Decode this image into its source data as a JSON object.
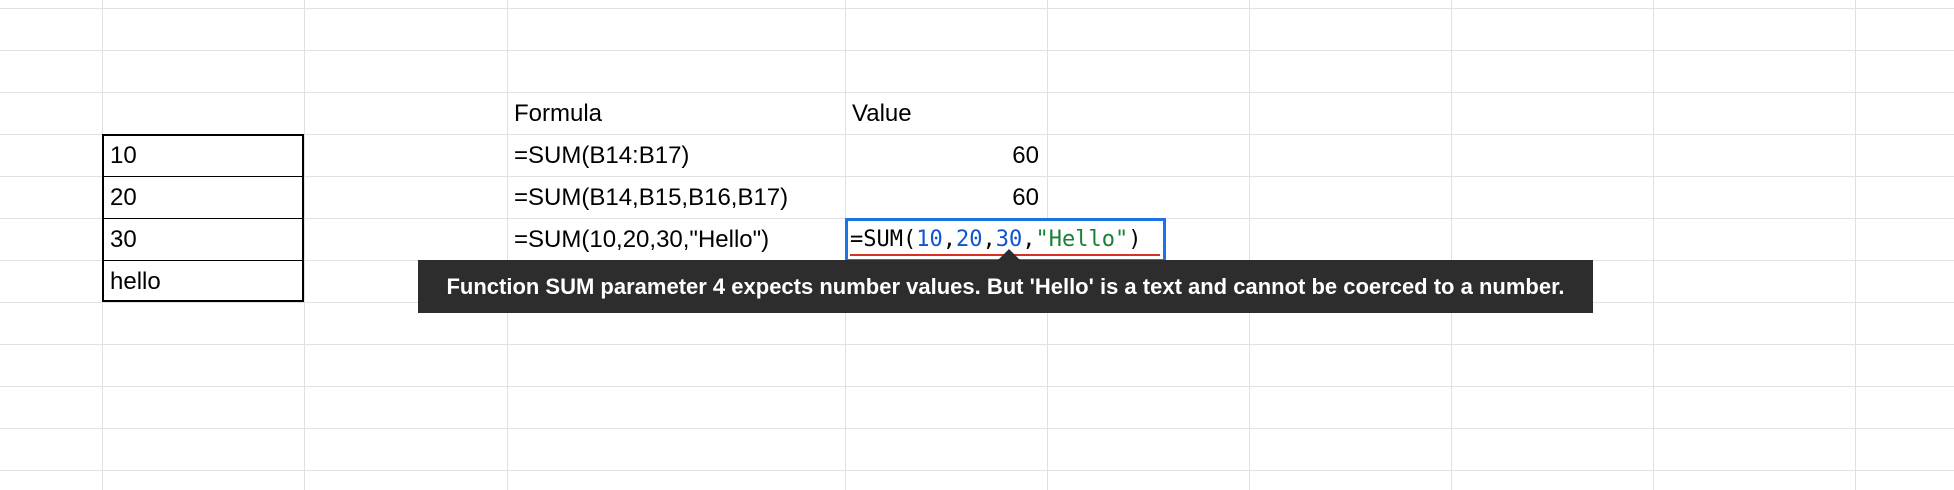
{
  "sheet": {
    "header_formula": "Formula",
    "header_value": "Value",
    "column_b": [
      "10",
      "20",
      "30",
      "hello"
    ],
    "formulas": [
      "=SUM(B14:B17)",
      "=SUM(B14,B15,B16,B17)",
      "=SUM(10,20,30,\"Hello\")"
    ],
    "values": [
      "60",
      "60"
    ]
  },
  "editor": {
    "tokens": {
      "prefix": "=SUM(",
      "n1": "10",
      "c1": ",",
      "n2": "20",
      "c2": ",",
      "n3": "30",
      "c3": ",",
      "str": "\"Hello\"",
      "close": ")"
    }
  },
  "tooltip": {
    "message": "Function SUM parameter 4 expects number values. But 'Hello' is a text and cannot be coerced to a number."
  },
  "colors": {
    "grid_line": "#e1e1e1",
    "active_cell_border": "#1a73e8",
    "number_token": "#1155cc",
    "string_token": "#188038",
    "error_underline": "#d93025",
    "tooltip_bg": "#2d2d2d"
  }
}
